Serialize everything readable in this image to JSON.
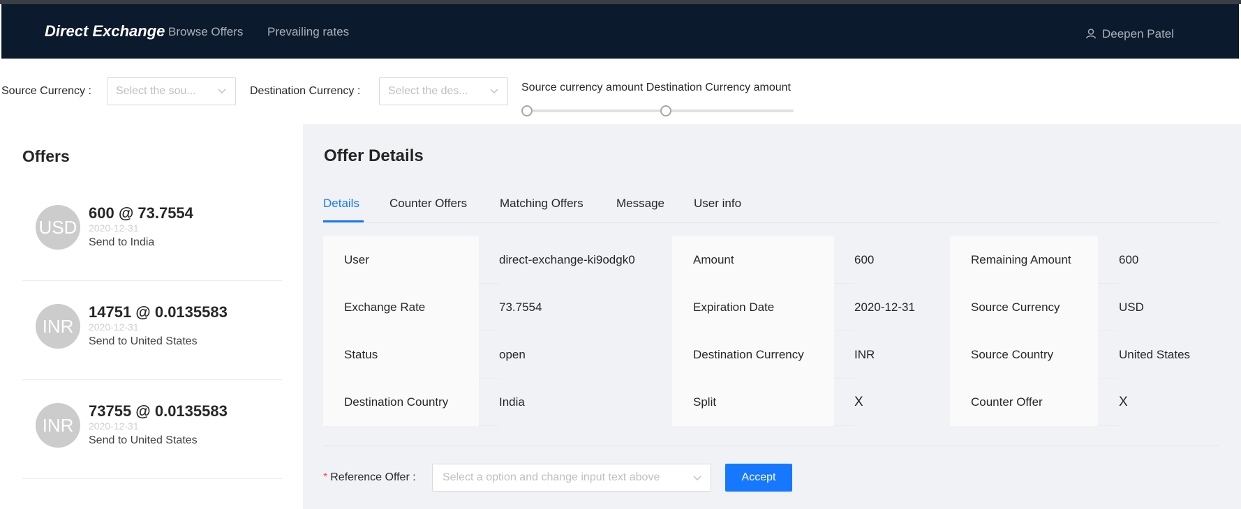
{
  "header": {
    "brand": "Direct Exchange",
    "nav": [
      "Browse Offers",
      "Prevailing rates"
    ],
    "user_name": "Deepen Patel"
  },
  "filters": {
    "source_label": "Source Currency",
    "source_placeholder": "Select the sou...",
    "dest_label": "Destination Currency",
    "dest_placeholder": "Select the des...",
    "slider_label": "Source currency amount Destination Currency amount"
  },
  "offers": {
    "title": "Offers",
    "items": [
      {
        "avatar": "USD",
        "title": "600 @ 73.7554",
        "date": "2020-12-31",
        "desc": "Send to India"
      },
      {
        "avatar": "INR",
        "title": "14751 @ 0.0135583",
        "date": "2020-12-31",
        "desc": "Send to United States"
      },
      {
        "avatar": "INR",
        "title": "73755 @ 0.0135583",
        "date": "2020-12-31",
        "desc": "Send to United States"
      }
    ]
  },
  "details": {
    "title": "Offer Details",
    "tabs": [
      "Details",
      "Counter Offers",
      "Matching Offers",
      "Message",
      "User info"
    ],
    "active_tab": "Details",
    "rows": [
      [
        [
          "User",
          "direct-exchange-ki9odgk0"
        ],
        [
          "Amount",
          "600"
        ],
        [
          "Remaining Amount",
          "600"
        ]
      ],
      [
        [
          "Exchange Rate",
          "73.7554"
        ],
        [
          "Expiration Date",
          "2020-12-31"
        ],
        [
          "Source Currency",
          "USD"
        ]
      ],
      [
        [
          "Status",
          "open"
        ],
        [
          "Destination Currency",
          "INR"
        ],
        [
          "Source Country",
          "United States"
        ]
      ],
      [
        [
          "Destination Country",
          "India"
        ],
        [
          "Split",
          "X"
        ],
        [
          "Counter Offer",
          "X"
        ]
      ]
    ],
    "reference_label": "Reference Offer",
    "reference_required_mark": "*",
    "reference_placeholder": "Select a option and change input text above",
    "accept_label": "Accept"
  },
  "colors": {
    "header_bg": "#0b1a2c",
    "primary": "#1677ff",
    "panel_bg": "#f0f2f5",
    "avatar_bg": "#cccccc"
  },
  "icons": {
    "user": "user-icon",
    "chevron": "chevron-down-icon"
  }
}
